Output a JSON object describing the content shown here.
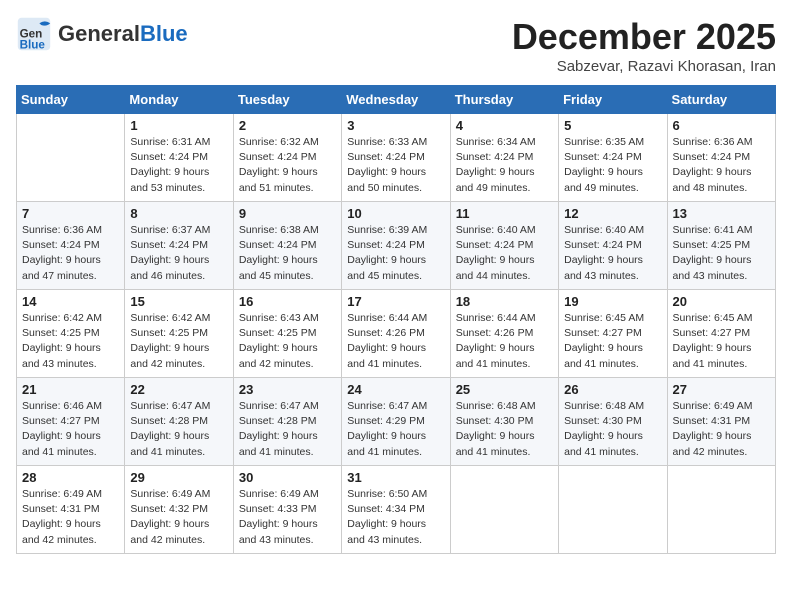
{
  "header": {
    "logo": {
      "general": "General",
      "blue": "Blue"
    },
    "title": "December 2025",
    "subtitle": "Sabzevar, Razavi Khorasan, Iran"
  },
  "weekdays": [
    "Sunday",
    "Monday",
    "Tuesday",
    "Wednesday",
    "Thursday",
    "Friday",
    "Saturday"
  ],
  "weeks": [
    [
      {
        "day": "",
        "info": ""
      },
      {
        "day": "1",
        "info": "Sunrise: 6:31 AM\nSunset: 4:24 PM\nDaylight: 9 hours\nand 53 minutes."
      },
      {
        "day": "2",
        "info": "Sunrise: 6:32 AM\nSunset: 4:24 PM\nDaylight: 9 hours\nand 51 minutes."
      },
      {
        "day": "3",
        "info": "Sunrise: 6:33 AM\nSunset: 4:24 PM\nDaylight: 9 hours\nand 50 minutes."
      },
      {
        "day": "4",
        "info": "Sunrise: 6:34 AM\nSunset: 4:24 PM\nDaylight: 9 hours\nand 49 minutes."
      },
      {
        "day": "5",
        "info": "Sunrise: 6:35 AM\nSunset: 4:24 PM\nDaylight: 9 hours\nand 49 minutes."
      },
      {
        "day": "6",
        "info": "Sunrise: 6:36 AM\nSunset: 4:24 PM\nDaylight: 9 hours\nand 48 minutes."
      }
    ],
    [
      {
        "day": "7",
        "info": "Sunrise: 6:36 AM\nSunset: 4:24 PM\nDaylight: 9 hours\nand 47 minutes."
      },
      {
        "day": "8",
        "info": "Sunrise: 6:37 AM\nSunset: 4:24 PM\nDaylight: 9 hours\nand 46 minutes."
      },
      {
        "day": "9",
        "info": "Sunrise: 6:38 AM\nSunset: 4:24 PM\nDaylight: 9 hours\nand 45 minutes."
      },
      {
        "day": "10",
        "info": "Sunrise: 6:39 AM\nSunset: 4:24 PM\nDaylight: 9 hours\nand 45 minutes."
      },
      {
        "day": "11",
        "info": "Sunrise: 6:40 AM\nSunset: 4:24 PM\nDaylight: 9 hours\nand 44 minutes."
      },
      {
        "day": "12",
        "info": "Sunrise: 6:40 AM\nSunset: 4:24 PM\nDaylight: 9 hours\nand 43 minutes."
      },
      {
        "day": "13",
        "info": "Sunrise: 6:41 AM\nSunset: 4:25 PM\nDaylight: 9 hours\nand 43 minutes."
      }
    ],
    [
      {
        "day": "14",
        "info": "Sunrise: 6:42 AM\nSunset: 4:25 PM\nDaylight: 9 hours\nand 43 minutes."
      },
      {
        "day": "15",
        "info": "Sunrise: 6:42 AM\nSunset: 4:25 PM\nDaylight: 9 hours\nand 42 minutes."
      },
      {
        "day": "16",
        "info": "Sunrise: 6:43 AM\nSunset: 4:25 PM\nDaylight: 9 hours\nand 42 minutes."
      },
      {
        "day": "17",
        "info": "Sunrise: 6:44 AM\nSunset: 4:26 PM\nDaylight: 9 hours\nand 41 minutes."
      },
      {
        "day": "18",
        "info": "Sunrise: 6:44 AM\nSunset: 4:26 PM\nDaylight: 9 hours\nand 41 minutes."
      },
      {
        "day": "19",
        "info": "Sunrise: 6:45 AM\nSunset: 4:27 PM\nDaylight: 9 hours\nand 41 minutes."
      },
      {
        "day": "20",
        "info": "Sunrise: 6:45 AM\nSunset: 4:27 PM\nDaylight: 9 hours\nand 41 minutes."
      }
    ],
    [
      {
        "day": "21",
        "info": "Sunrise: 6:46 AM\nSunset: 4:27 PM\nDaylight: 9 hours\nand 41 minutes."
      },
      {
        "day": "22",
        "info": "Sunrise: 6:47 AM\nSunset: 4:28 PM\nDaylight: 9 hours\nand 41 minutes."
      },
      {
        "day": "23",
        "info": "Sunrise: 6:47 AM\nSunset: 4:28 PM\nDaylight: 9 hours\nand 41 minutes."
      },
      {
        "day": "24",
        "info": "Sunrise: 6:47 AM\nSunset: 4:29 PM\nDaylight: 9 hours\nand 41 minutes."
      },
      {
        "day": "25",
        "info": "Sunrise: 6:48 AM\nSunset: 4:30 PM\nDaylight: 9 hours\nand 41 minutes."
      },
      {
        "day": "26",
        "info": "Sunrise: 6:48 AM\nSunset: 4:30 PM\nDaylight: 9 hours\nand 41 minutes."
      },
      {
        "day": "27",
        "info": "Sunrise: 6:49 AM\nSunset: 4:31 PM\nDaylight: 9 hours\nand 42 minutes."
      }
    ],
    [
      {
        "day": "28",
        "info": "Sunrise: 6:49 AM\nSunset: 4:31 PM\nDaylight: 9 hours\nand 42 minutes."
      },
      {
        "day": "29",
        "info": "Sunrise: 6:49 AM\nSunset: 4:32 PM\nDaylight: 9 hours\nand 42 minutes."
      },
      {
        "day": "30",
        "info": "Sunrise: 6:49 AM\nSunset: 4:33 PM\nDaylight: 9 hours\nand 43 minutes."
      },
      {
        "day": "31",
        "info": "Sunrise: 6:50 AM\nSunset: 4:34 PM\nDaylight: 9 hours\nand 43 minutes."
      },
      {
        "day": "",
        "info": ""
      },
      {
        "day": "",
        "info": ""
      },
      {
        "day": "",
        "info": ""
      }
    ]
  ]
}
